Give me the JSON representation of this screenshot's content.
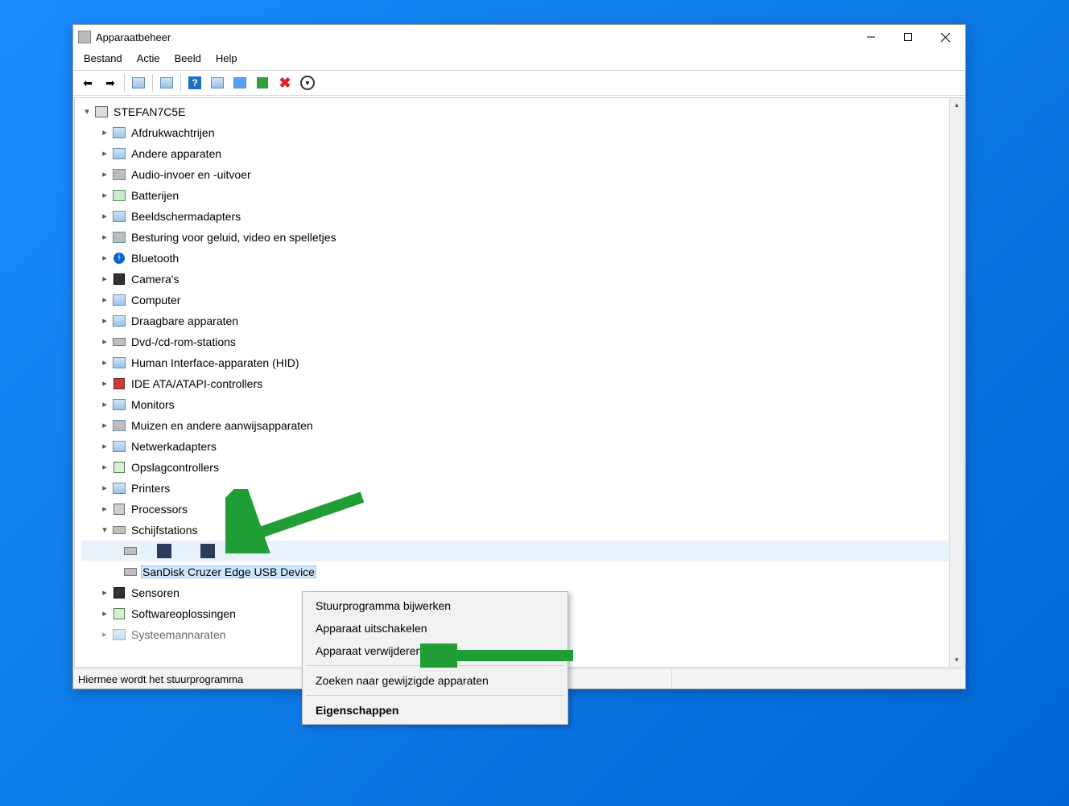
{
  "title": "Apparaatbeheer",
  "menu": {
    "file": "Bestand",
    "action": "Actie",
    "view": "Beeld",
    "help": "Help"
  },
  "root": "STEFAN7C5E",
  "categories": [
    "Afdrukwachtrijen",
    "Andere apparaten",
    "Audio-invoer en -uitvoer",
    "Batterijen",
    "Beeldschermadapters",
    "Besturing voor geluid, video en spelletjes",
    "Bluetooth",
    "Camera's",
    "Computer",
    "Draagbare apparaten",
    "Dvd-/cd-rom-stations",
    "Human Interface-apparaten (HID)",
    "IDE ATA/ATAPI-controllers",
    "Monitors",
    "Muizen en andere aanwijsapparaten",
    "Netwerkadapters",
    "Opslagcontrollers",
    "Printers",
    "Processors",
    "Schijfstations",
    "Sensoren",
    "Softwareoplossingen",
    "Systeemannaraten"
  ],
  "selected_device": "SanDisk Cruzer Edge USB Device",
  "context_menu": {
    "update": "Stuurprogramma bijwerken",
    "disable": "Apparaat uitschakelen",
    "uninstall": "Apparaat verwijderen",
    "scan": "Zoeken naar gewijzigde apparaten",
    "properties": "Eigenschappen"
  },
  "status": "Hiermee wordt het stuurprogramma"
}
